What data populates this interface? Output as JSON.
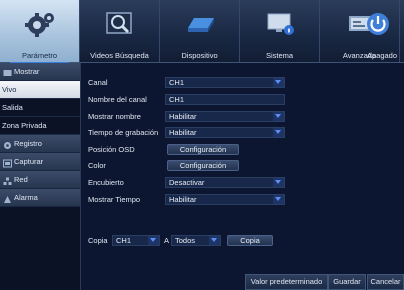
{
  "topnav": {
    "items": [
      {
        "label": "Parámetro",
        "icon": "gears-icon",
        "active": true
      },
      {
        "label": "Videos Búsqueda",
        "icon": "magnifier-video-icon"
      },
      {
        "label": "Dispositivo",
        "icon": "hard-drive-icon"
      },
      {
        "label": "Sistema",
        "icon": "monitor-info-icon"
      },
      {
        "label": "Avanzada",
        "icon": "advanced-settings-icon"
      },
      {
        "label": "Apagado",
        "icon": "power-icon"
      }
    ]
  },
  "sidebar": {
    "mostrar": "Mostrar",
    "vivo": "Vivo",
    "salida": "Salida",
    "zona_privada": "Zona Privada",
    "registro": "Registro",
    "capturar": "Capturar",
    "red": "Red",
    "alarma": "Alarma"
  },
  "form": {
    "canal": {
      "label": "Canal",
      "value": "CH1"
    },
    "nombre_canal": {
      "label": "Nombre del canal",
      "value": "CH1"
    },
    "mostrar_nombre": {
      "label": "Mostrar nombre",
      "value": "Habilitar"
    },
    "tiempo_grabacion": {
      "label": "Tiempo de grabación",
      "value": "Habilitar"
    },
    "posicion_osd": {
      "label": "Posición OSD",
      "button": "Configuración"
    },
    "color": {
      "label": "Color",
      "button": "Configuración"
    },
    "encubierto": {
      "label": "Encubierto",
      "value": "Desactivar"
    },
    "mostrar_tiempo": {
      "label": "Mostrar Tiempo",
      "value": "Habilitar"
    }
  },
  "copy": {
    "label": "Copia",
    "from": "CH1",
    "to_label": "A",
    "to": "Todos",
    "button": "Copia"
  },
  "actions": {
    "default": "Valor predeterminado",
    "save": "Guardar",
    "cancel": "Cancelar"
  },
  "colors": {
    "background": "#0b1226",
    "accent": "#3b7de0",
    "active_tab": "#a8c2dc"
  }
}
